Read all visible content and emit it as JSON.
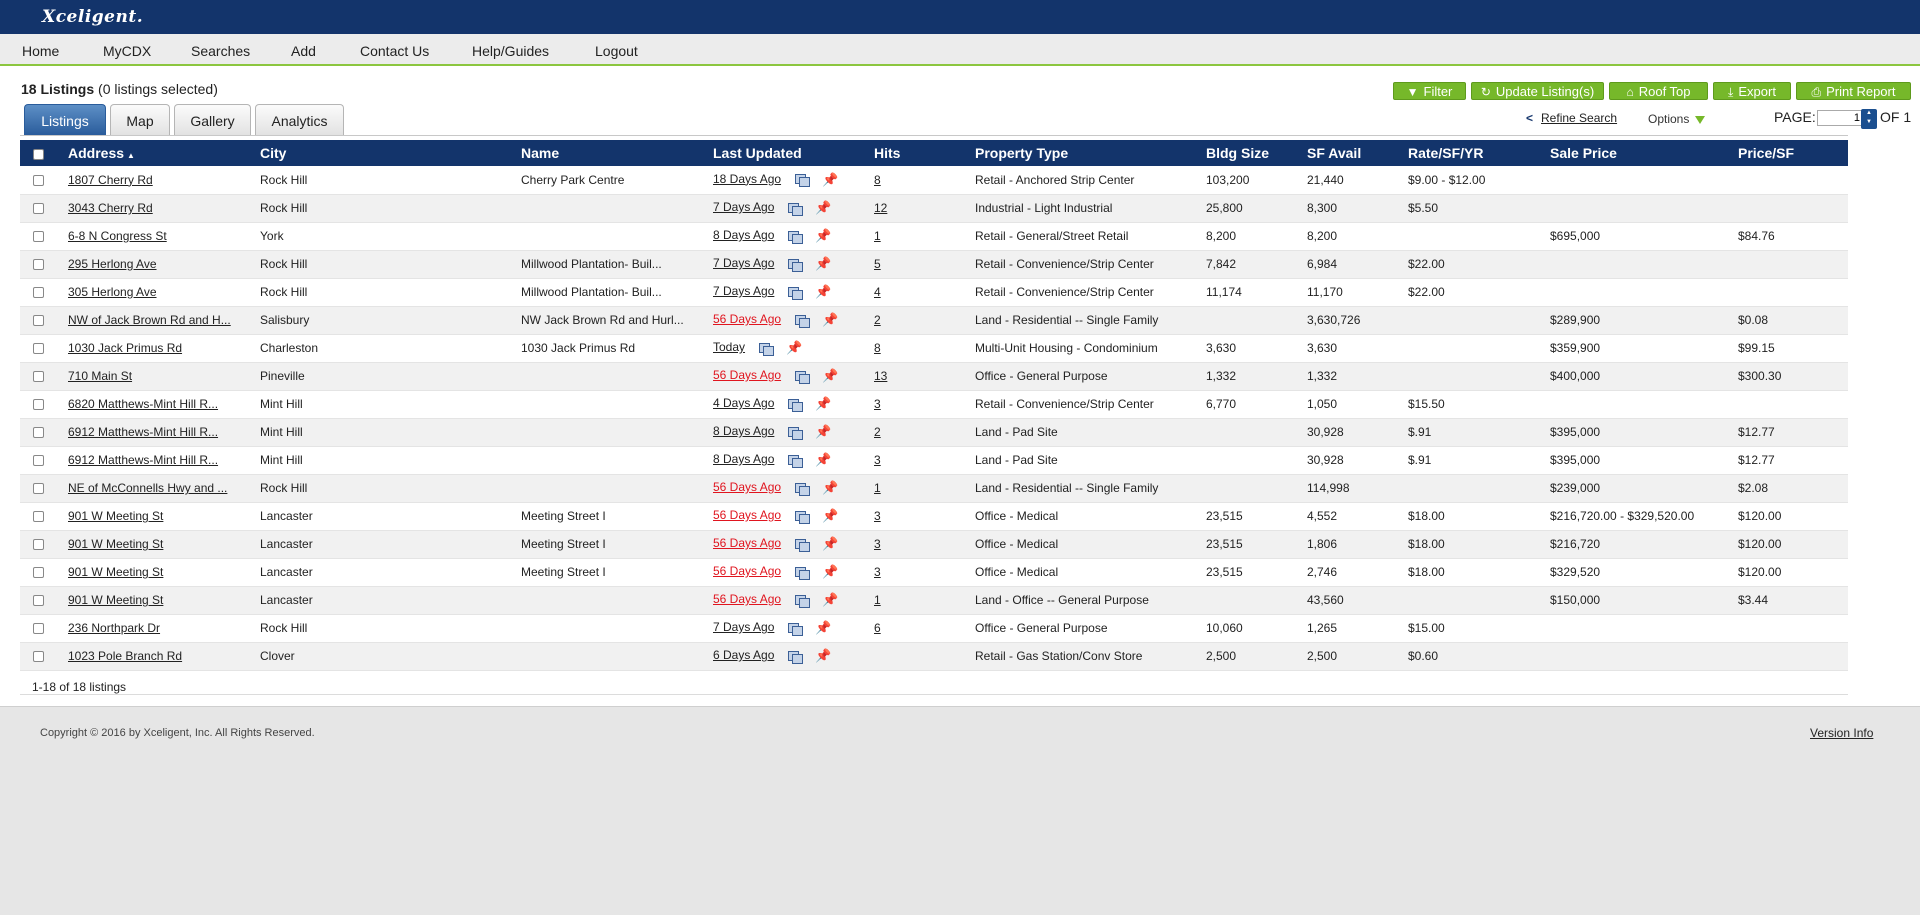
{
  "header": {
    "logo": "Xceligent."
  },
  "nav": [
    "Home",
    "MyCDX",
    "Searches",
    "Add",
    "Contact Us",
    "Help/Guides",
    "Logout"
  ],
  "summary": {
    "count": "18 Listings",
    "selected": "(0 listings selected)"
  },
  "tabs": [
    "Listings",
    "Map",
    "Gallery",
    "Analytics"
  ],
  "actions": {
    "filter": "Filter",
    "update": "Update Listing(s)",
    "rooftop": "Roof Top",
    "export": "Export",
    "print": "Print Report"
  },
  "toolbar": {
    "refine": "Refine Search",
    "options": "Options",
    "page_label": "PAGE:",
    "page_value": "1",
    "page_of": "OF 1"
  },
  "table": {
    "columns": [
      "Address",
      "City",
      "Name",
      "Last Updated",
      "Hits",
      "Property Type",
      "Bldg Size",
      "SF Avail",
      "Rate/SF/YR",
      "Sale Price",
      "Price/SF"
    ],
    "rows": [
      {
        "address": "1807 Cherry Rd",
        "city": "Rock Hill",
        "name": "Cherry Park Centre",
        "updated": "18 Days Ago",
        "red": false,
        "pin_only": false,
        "hits": "8",
        "type": "Retail - Anchored Strip Center",
        "bldg": "103,200",
        "sf": "21,440",
        "rate": "$9.00 - $12.00",
        "sale": "",
        "psf": ""
      },
      {
        "address": "3043 Cherry Rd",
        "city": "Rock Hill",
        "name": "",
        "updated": "7 Days Ago",
        "red": false,
        "pin_only": false,
        "hits": "12",
        "type": "Industrial - Light Industrial",
        "bldg": "25,800",
        "sf": "8,300",
        "rate": "$5.50",
        "sale": "",
        "psf": ""
      },
      {
        "address": "6-8 N Congress St",
        "city": "York",
        "name": "",
        "updated": "8 Days Ago",
        "red": false,
        "pin_only": false,
        "hits": "1",
        "type": "Retail - General/Street Retail",
        "bldg": "8,200",
        "sf": "8,200",
        "rate": "",
        "sale": "$695,000",
        "psf": "$84.76"
      },
      {
        "address": "295 Herlong Ave",
        "city": "Rock Hill",
        "name": "Millwood Plantation- Buil...",
        "updated": "7 Days Ago",
        "red": false,
        "pin_only": false,
        "hits": "5",
        "type": "Retail - Convenience/Strip Center",
        "bldg": "7,842",
        "sf": "6,984",
        "rate": "$22.00",
        "sale": "",
        "psf": ""
      },
      {
        "address": "305 Herlong Ave",
        "city": "Rock Hill",
        "name": "Millwood Plantation- Buil...",
        "updated": "7 Days Ago",
        "red": false,
        "pin_only": false,
        "hits": "4",
        "type": "Retail - Convenience/Strip Center",
        "bldg": "11,174",
        "sf": "11,170",
        "rate": "$22.00",
        "sale": "",
        "psf": ""
      },
      {
        "address": "NW of Jack Brown Rd and H...",
        "city": "Salisbury",
        "name": "NW Jack Brown Rd and Hurl...",
        "updated": "56 Days Ago",
        "red": true,
        "pin_only": false,
        "hits": "2",
        "type": "Land - Residential -- Single Family",
        "bldg": "",
        "sf": "3,630,726",
        "rate": "",
        "sale": "$289,900",
        "psf": "$0.08"
      },
      {
        "address": "1030 Jack Primus Rd",
        "city": "Charleston",
        "name": "1030 Jack Primus Rd",
        "updated": "Today",
        "red": false,
        "pin_only": false,
        "hits": "8",
        "type": "Multi-Unit Housing - Condominium",
        "bldg": "3,630",
        "sf": "3,630",
        "rate": "",
        "sale": "$359,900",
        "psf": "$99.15"
      },
      {
        "address": "710 Main St",
        "city": "Pineville",
        "name": "",
        "updated": "56 Days Ago",
        "red": true,
        "pin_only": false,
        "hits": "13",
        "type": "Office - General Purpose",
        "bldg": "1,332",
        "sf": "1,332",
        "rate": "",
        "sale": "$400,000",
        "psf": "$300.30"
      },
      {
        "address": "6820 Matthews-Mint Hill R...",
        "city": "Mint Hill",
        "name": "",
        "updated": "4 Days Ago",
        "red": false,
        "pin_only": false,
        "hits": "3",
        "type": "Retail - Convenience/Strip Center",
        "bldg": "6,770",
        "sf": "1,050",
        "rate": "$15.50",
        "sale": "",
        "psf": ""
      },
      {
        "address": "6912 Matthews-Mint Hill R...",
        "city": "Mint Hill",
        "name": "",
        "updated": "8 Days Ago",
        "red": false,
        "pin_only": false,
        "hits": "2",
        "type": "Land - Pad Site",
        "bldg": "",
        "sf": "30,928",
        "rate": "$.91",
        "sale": "$395,000",
        "psf": "$12.77"
      },
      {
        "address": "6912 Matthews-Mint Hill R...",
        "city": "Mint Hill",
        "name": "",
        "updated": "8 Days Ago",
        "red": false,
        "pin_only": false,
        "hits": "3",
        "type": "Land - Pad Site",
        "bldg": "",
        "sf": "30,928",
        "rate": "$.91",
        "sale": "$395,000",
        "psf": "$12.77"
      },
      {
        "address": "NE of McConnells Hwy and ...",
        "city": "Rock Hill",
        "name": "",
        "updated": "56 Days Ago",
        "red": true,
        "pin_only": false,
        "hits": "1",
        "type": "Land - Residential -- Single Family",
        "bldg": "",
        "sf": "114,998",
        "rate": "",
        "sale": "$239,000",
        "psf": "$2.08"
      },
      {
        "address": "901 W Meeting St",
        "city": "Lancaster",
        "name": "Meeting Street I",
        "updated": "56 Days Ago",
        "red": true,
        "pin_only": false,
        "hits": "3",
        "type": "Office - Medical",
        "bldg": "23,515",
        "sf": "4,552",
        "rate": "$18.00",
        "sale": "$216,720.00 - $329,520.00",
        "psf": "$120.00"
      },
      {
        "address": "901 W Meeting St",
        "city": "Lancaster",
        "name": "Meeting Street I",
        "updated": "56 Days Ago",
        "red": true,
        "pin_only": false,
        "hits": "3",
        "type": "Office - Medical",
        "bldg": "23,515",
        "sf": "1,806",
        "rate": "$18.00",
        "sale": "$216,720",
        "psf": "$120.00"
      },
      {
        "address": "901 W Meeting St",
        "city": "Lancaster",
        "name": "Meeting Street I",
        "updated": "56 Days Ago",
        "red": true,
        "pin_only": false,
        "hits": "3",
        "type": "Office - Medical",
        "bldg": "23,515",
        "sf": "2,746",
        "rate": "$18.00",
        "sale": "$329,520",
        "psf": "$120.00"
      },
      {
        "address": "901 W Meeting St",
        "city": "Lancaster",
        "name": "",
        "updated": "56 Days Ago",
        "red": true,
        "pin_only": false,
        "hits": "1",
        "type": "Land - Office -- General Purpose",
        "bldg": "",
        "sf": "43,560",
        "rate": "",
        "sale": "$150,000",
        "psf": "$3.44"
      },
      {
        "address": "236 Northpark Dr",
        "city": "Rock Hill",
        "name": "",
        "updated": "7 Days Ago",
        "red": false,
        "pin_only": false,
        "hits": "6",
        "type": "Office - General Purpose",
        "bldg": "10,060",
        "sf": "1,265",
        "rate": "$15.00",
        "sale": "",
        "psf": ""
      },
      {
        "address": "1023 Pole Branch Rd",
        "city": "Clover",
        "name": "",
        "updated": "6 Days Ago",
        "red": false,
        "pin_only": false,
        "hits": "",
        "type": "Retail - Gas Station/Conv Store",
        "bldg": "2,500",
        "sf": "2,500",
        "rate": "$0.60",
        "sale": "",
        "psf": ""
      }
    ]
  },
  "range_text": "1-18 of 18 listings",
  "footer": {
    "copyright": "Copyright © 2016 by Xceligent, Inc. All Rights Reserved.",
    "version": "Version Info"
  },
  "colors": {
    "header_bg": "#13346b",
    "accent_green": "#76b82a",
    "overdue_red": "#e0151f"
  },
  "icons": {
    "filter": "funnel-icon",
    "update": "refresh-icon",
    "rooftop": "roof-icon",
    "export": "download-icon",
    "print": "printer-icon",
    "copy": "copy-icon",
    "pin": "pushpin-icon"
  }
}
